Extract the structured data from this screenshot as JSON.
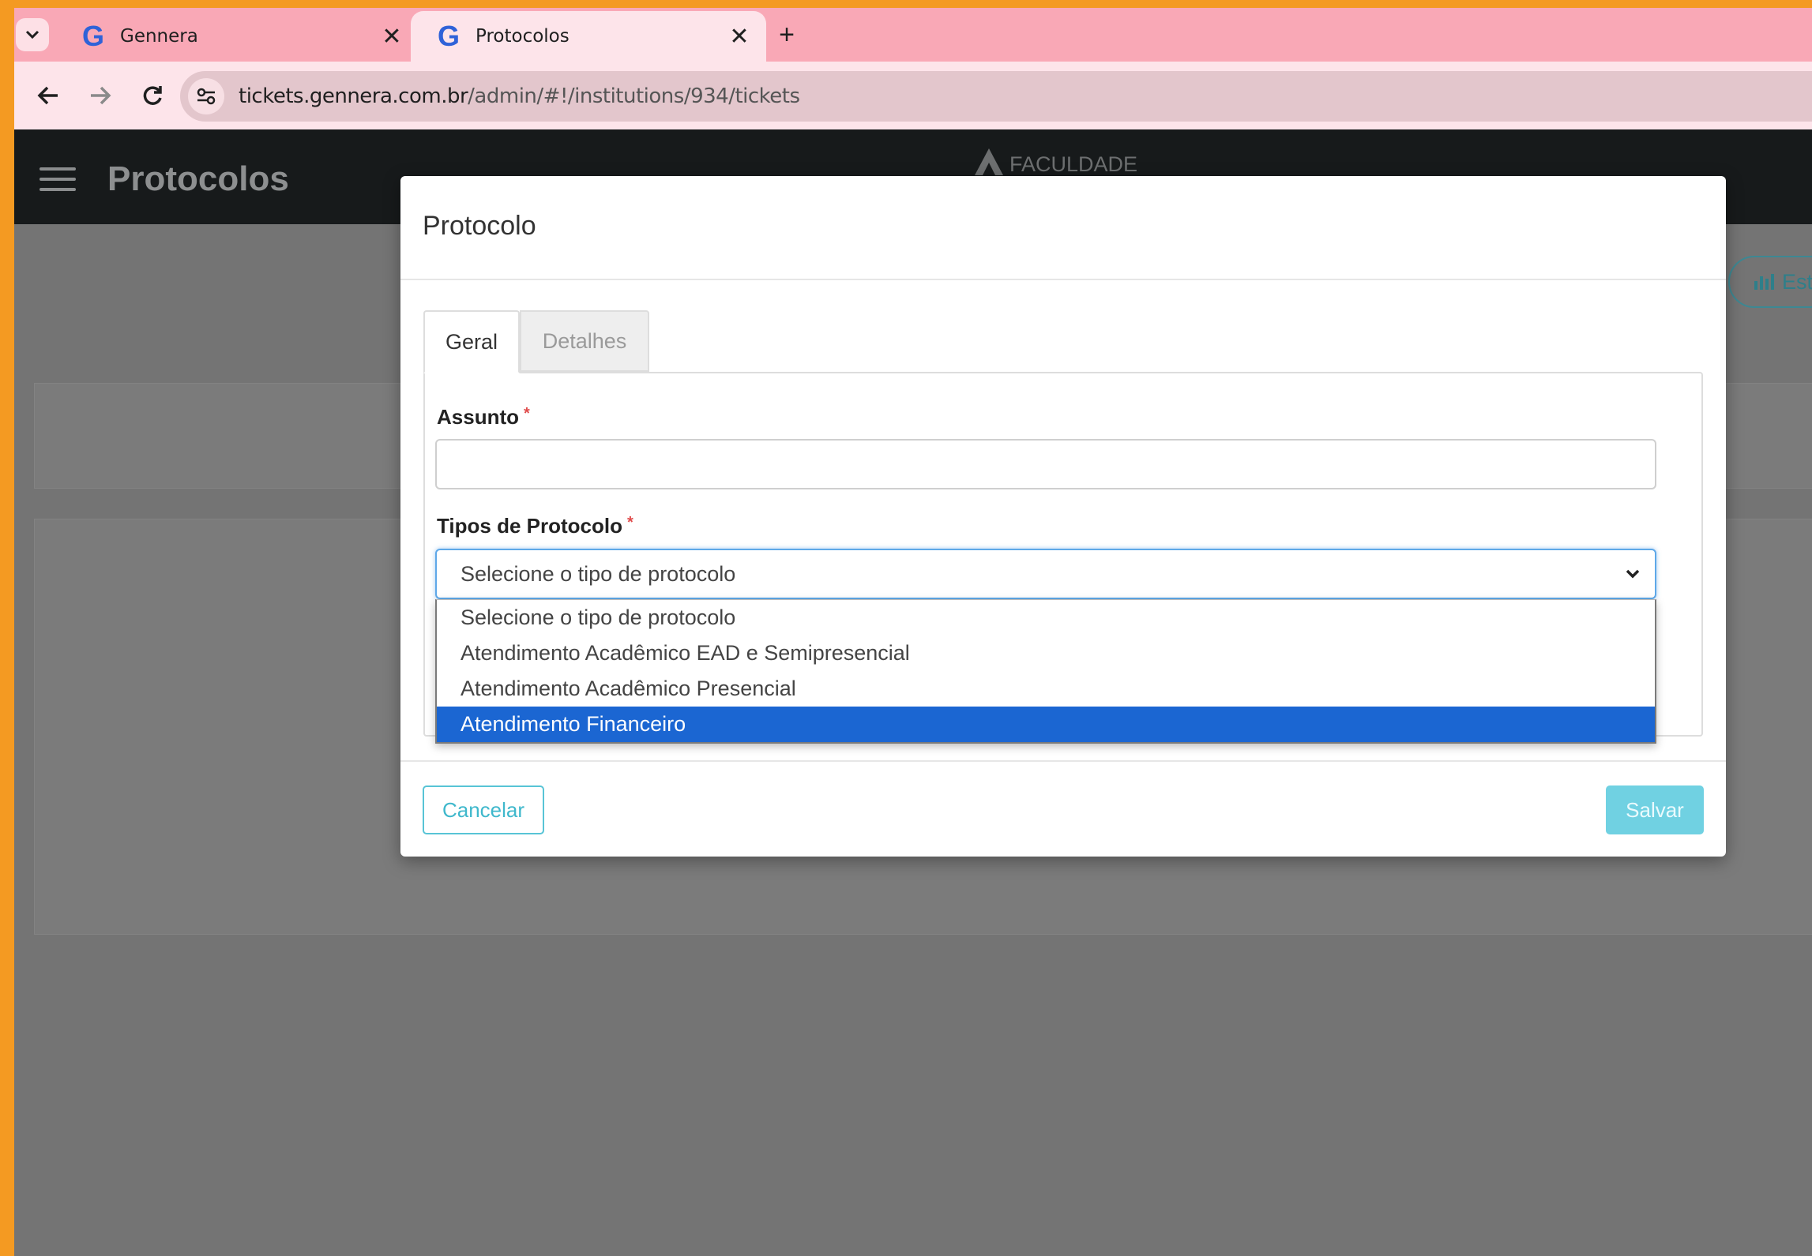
{
  "browser": {
    "tabs": [
      {
        "title": "Gennera",
        "favicon": "G"
      },
      {
        "title": "Protocolos",
        "favicon": "G"
      }
    ],
    "url_host": "tickets.gennera.com.br",
    "url_path": "/admin/#!/institutions/934/tickets"
  },
  "app": {
    "title": "Protocolos",
    "brand": "FACULDADE",
    "stats_button": "Est"
  },
  "modal": {
    "title": "Protocolo",
    "tabs": [
      "Geral",
      "Detalhes"
    ],
    "subject_label": "Assunto",
    "subject_value": "",
    "required_mark": "*",
    "type_label": "Tipos de Protocolo",
    "type_selected": "Selecione o tipo de protocolo",
    "type_options": [
      "Selecione o tipo de protocolo",
      "Atendimento Acadêmico EAD e Semipresencial",
      "Atendimento Acadêmico Presencial",
      "Atendimento Financeiro"
    ],
    "highlighted_option_index": 3,
    "cancel_label": "Cancelar",
    "save_label": "Salvar"
  },
  "colors": {
    "accent": "#1b66d2",
    "teal": "#58c4d6",
    "frame_border": "#f49a22",
    "tabstrip": "#f9a8b6"
  }
}
